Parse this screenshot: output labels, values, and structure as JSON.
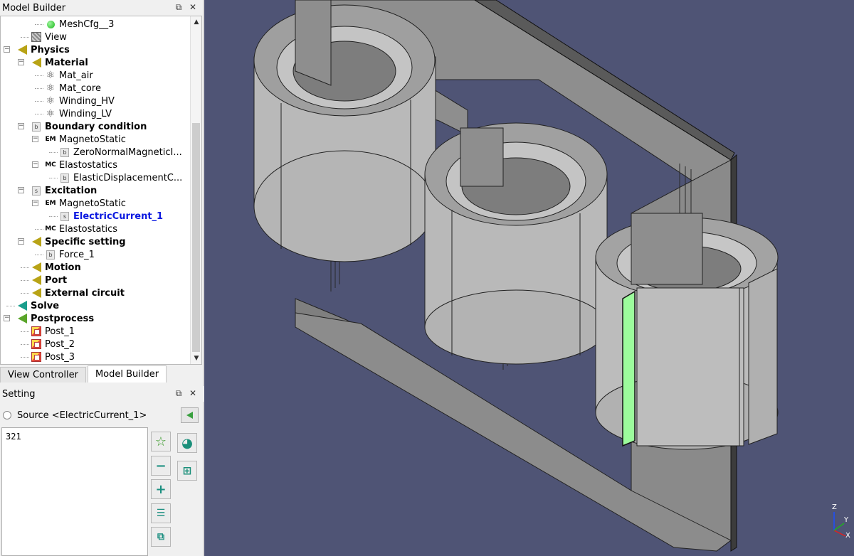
{
  "model_builder": {
    "title": "Model Builder",
    "float_icon": "float-icon",
    "close_icon": "close-icon",
    "tree": [
      {
        "label": "MeshCfg__3",
        "icon": "green-dot-icon",
        "bold": false
      },
      {
        "label": "View",
        "icon": "view-icon",
        "bold": false
      },
      {
        "label": "Physics",
        "icon": "triangle-gold-icon",
        "bold": true
      },
      {
        "label": "Material",
        "icon": "triangle-gold-icon",
        "bold": true
      },
      {
        "label": "Mat_air",
        "icon": "atom-icon",
        "bold": false
      },
      {
        "label": "Mat_core",
        "icon": "atom-icon",
        "bold": false
      },
      {
        "label": "Winding_HV",
        "icon": "atom-icon",
        "bold": false
      },
      {
        "label": "Winding_LV",
        "icon": "atom-icon",
        "bold": false
      },
      {
        "label": "Boundary condition",
        "icon": "b-icon",
        "bold": true
      },
      {
        "label": "MagnetoStatic",
        "icon": "em-icon",
        "bold": false
      },
      {
        "label": "ZeroNormalMagneticI...",
        "icon": "b-icon",
        "bold": false
      },
      {
        "label": "Elastostatics",
        "icon": "mc-icon",
        "bold": false
      },
      {
        "label": "ElasticDisplacementC...",
        "icon": "b-icon",
        "bold": false
      },
      {
        "label": "Excitation",
        "icon": "s-icon",
        "bold": true
      },
      {
        "label": "MagnetoStatic",
        "icon": "em-icon",
        "bold": false
      },
      {
        "label": "ElectricCurrent_1",
        "icon": "s-icon",
        "bold": true,
        "selected": true
      },
      {
        "label": "Elastostatics",
        "icon": "mc-icon",
        "bold": false
      },
      {
        "label": "Specific setting",
        "icon": "triangle-gold-icon",
        "bold": true
      },
      {
        "label": "Force_1",
        "icon": "b-icon",
        "bold": false
      },
      {
        "label": "Motion",
        "icon": "triangle-gold-icon",
        "bold": true
      },
      {
        "label": "Port",
        "icon": "triangle-gold-icon",
        "bold": true
      },
      {
        "label": "External circuit",
        "icon": "triangle-gold-icon",
        "bold": true
      },
      {
        "label": "Solve",
        "icon": "triangle-teal-icon",
        "bold": true
      },
      {
        "label": "Postprocess",
        "icon": "triangle-green-icon",
        "bold": true
      },
      {
        "label": "Post_1",
        "icon": "post-icon",
        "bold": false
      },
      {
        "label": "Post_2",
        "icon": "post-icon",
        "bold": false
      },
      {
        "label": "Post_3",
        "icon": "post-icon",
        "bold": false
      }
    ],
    "icon_letters": {
      "b": "b",
      "s": "s",
      "em": "EM",
      "mc": "MC"
    }
  },
  "tabs": {
    "view_controller": "View Controller",
    "model_builder": "Model Builder",
    "active": "Model Builder"
  },
  "setting": {
    "title": "Setting",
    "source_label": "Source <ElectricCurrent_1>",
    "content": "321",
    "toolbar": [
      "star-add-icon",
      "minus-icon",
      "plus-icon",
      "list-icon",
      "copy-add-icon"
    ],
    "side_buttons": [
      "refresh-icon",
      "grid-icon"
    ]
  },
  "viewport": {
    "background": "#4f5475",
    "core_color": "#8e8e8e",
    "coil_color": "#b8b8b8",
    "highlight_color": "#9cfc9c",
    "axis_labels": {
      "z": "Z",
      "y": "Y",
      "x": "X"
    }
  }
}
